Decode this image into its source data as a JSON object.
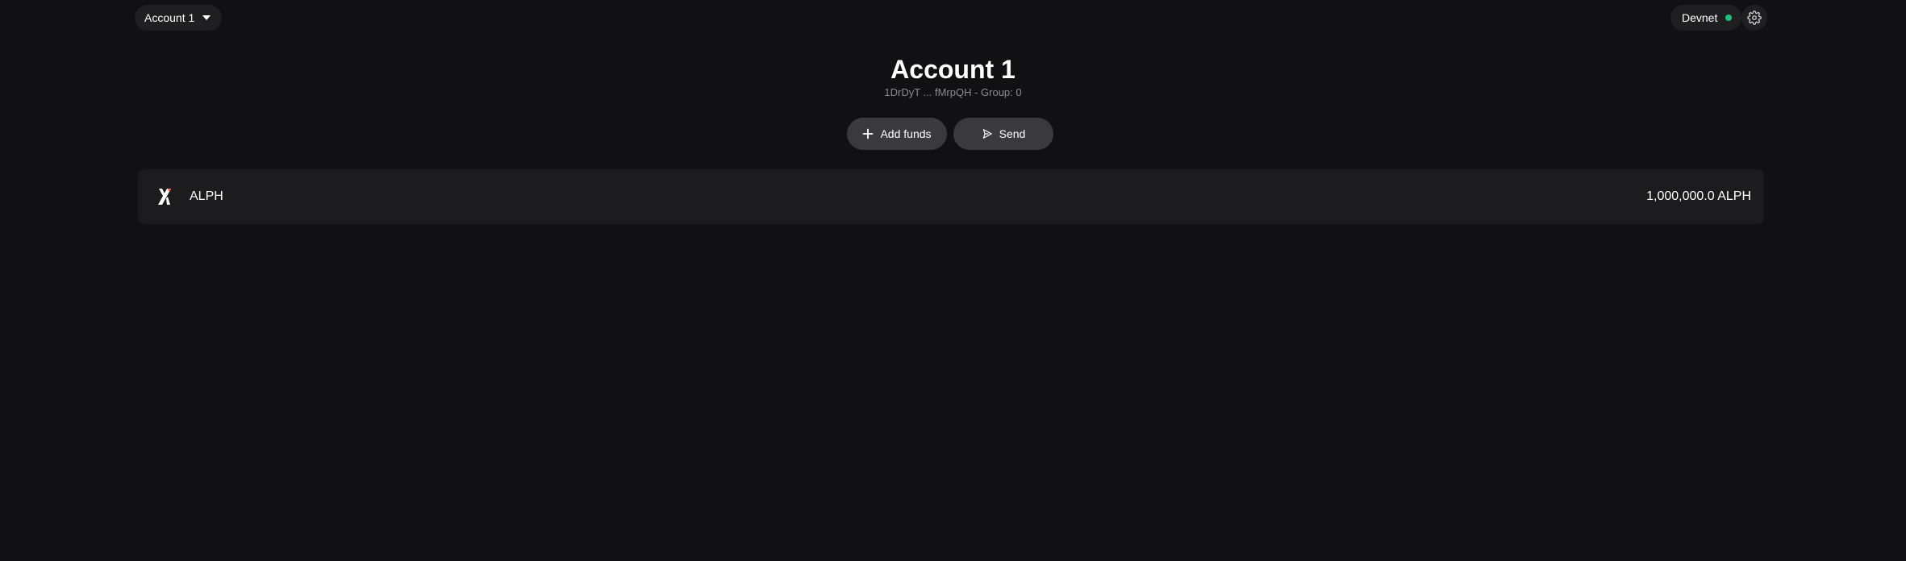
{
  "header": {
    "account_selector_label": "Account 1",
    "network_label": "Devnet",
    "network_status_color": "#1ec37a"
  },
  "account": {
    "title": "Account 1",
    "subtitle": "1DrDyT ... fMrpQH - Group: 0"
  },
  "actions": {
    "add_funds_label": "Add funds",
    "send_label": "Send"
  },
  "tokens": [
    {
      "symbol": "ALPH",
      "balance": "1,000,000.0 ALPH",
      "icon": "alephium-logo-icon"
    }
  ],
  "colors": {
    "background": "#111113",
    "accent": "#1ec37a",
    "logo_accent": "#ff5d51"
  },
  "icons": {
    "account_caret": "chevron-down-icon",
    "settings": "gear-icon",
    "add_funds": "plus-icon",
    "send": "send-icon"
  }
}
